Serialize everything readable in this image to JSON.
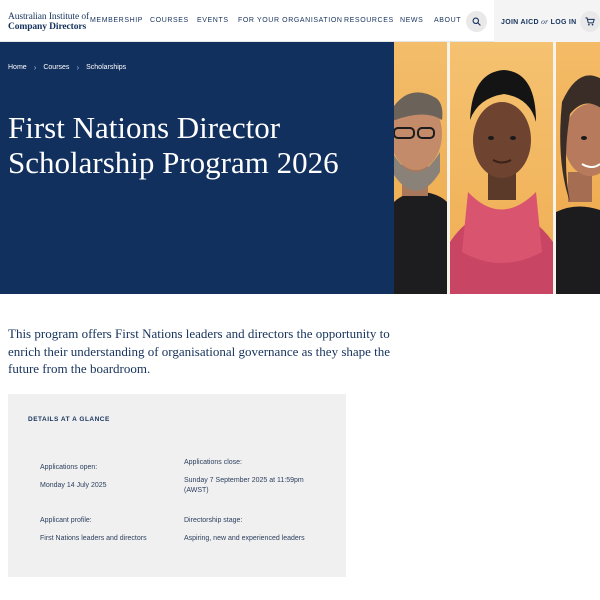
{
  "header": {
    "logo_line1": "Australian Institute of",
    "logo_line2": "Company Directors",
    "nav": [
      "MEMBERSHIP",
      "COURSES",
      "EVENTS",
      "FOR YOUR ORGANISATION",
      "RESOURCES",
      "NEWS",
      "ABOUT"
    ],
    "join": "JOIN AICD",
    "or": "or",
    "login": "LOG IN",
    "search_icon": "search-icon",
    "cart_icon": "cart-icon"
  },
  "hero": {
    "breadcrumb": [
      "Home",
      "Courses",
      "Scholarships"
    ],
    "title": "First Nations Director Scholarship Program 2026",
    "background_color": "#12305e"
  },
  "intro": "This program offers First Nations leaders and directors the opportunity to enrich their understanding of organisational governance as they shape the future from the boardroom.",
  "details": {
    "heading": "DETAILS AT A GLANCE",
    "applications_open_label": "Applications open:",
    "applications_open_value": "Monday 14 July 2025",
    "applications_close_label": "Applications close:",
    "applications_close_value_line1": "Sunday 7 September 2025 at 11:59pm",
    "applications_close_value_line2": "(AWST)",
    "applicant_profile_label": "Applicant profile:",
    "applicant_profile_value": "First Nations leaders and directors",
    "directorship_stage_label": "Directorship stage:",
    "directorship_stage_value": "Aspiring, new and experienced leaders"
  }
}
